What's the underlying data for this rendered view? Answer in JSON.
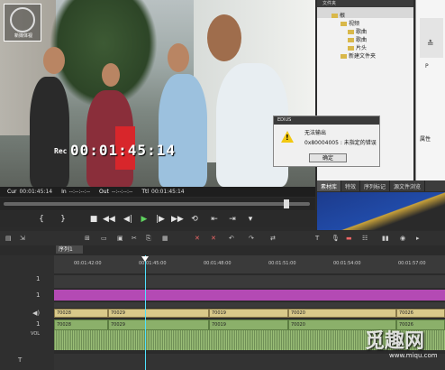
{
  "logo": {
    "text": "新媒体视"
  },
  "preview": {
    "rec_label": "Rec",
    "timecode": "00:01:45:14",
    "info": {
      "cur_label": "Cur",
      "cur_value": "00:01:45:14",
      "in_label": "In",
      "in_value": "--:--:--:--",
      "out_label": "Out",
      "out_value": "--:--:--:--",
      "ttl_label": "Ttl",
      "ttl_value": "00:01:45:14"
    },
    "scrub_progress": 0.93
  },
  "bin": {
    "title": "文件夹",
    "items": [
      {
        "label": "根"
      },
      {
        "label": "视频"
      },
      {
        "label": "歌曲"
      },
      {
        "label": "歌曲"
      },
      {
        "label": "片头"
      },
      {
        "label": "新建文件夹"
      }
    ]
  },
  "dialog": {
    "title": "EDIUS",
    "line1": "无法输出",
    "line2": "0x80004005 : 未指定的错误",
    "ok_label": "确定"
  },
  "side": {
    "p_label": "P",
    "props_label": "属性",
    "mark": "≛"
  },
  "tabs": [
    {
      "label": "素材库",
      "active": true
    },
    {
      "label": "特效"
    },
    {
      "label": "序列标记"
    },
    {
      "label": "源文件浏览"
    }
  ],
  "timeline": {
    "tab_label": "序列1",
    "ruler_ticks": [
      "00:01:42:00",
      "00:01:45:00",
      "00:01:48:00",
      "00:01:51:00",
      "00:01:54:00",
      "00:01:57:00"
    ],
    "video_clips": [
      "70028",
      "70029",
      "70019",
      "70020",
      "70026"
    ],
    "audio_clips": [
      "70028",
      "70029",
      "70019",
      "70020",
      "70026"
    ],
    "vol_label": "VOL",
    "track_labels": [
      "1",
      "1",
      "1"
    ]
  },
  "watermark": {
    "main": "觅趣网",
    "sub": "www.miqu.com"
  },
  "colors": {
    "playhead": "#4fe3ff",
    "clip_video": "#d9c98a",
    "clip_audio": "#8bb06a",
    "title_track": "#b44ab4"
  }
}
